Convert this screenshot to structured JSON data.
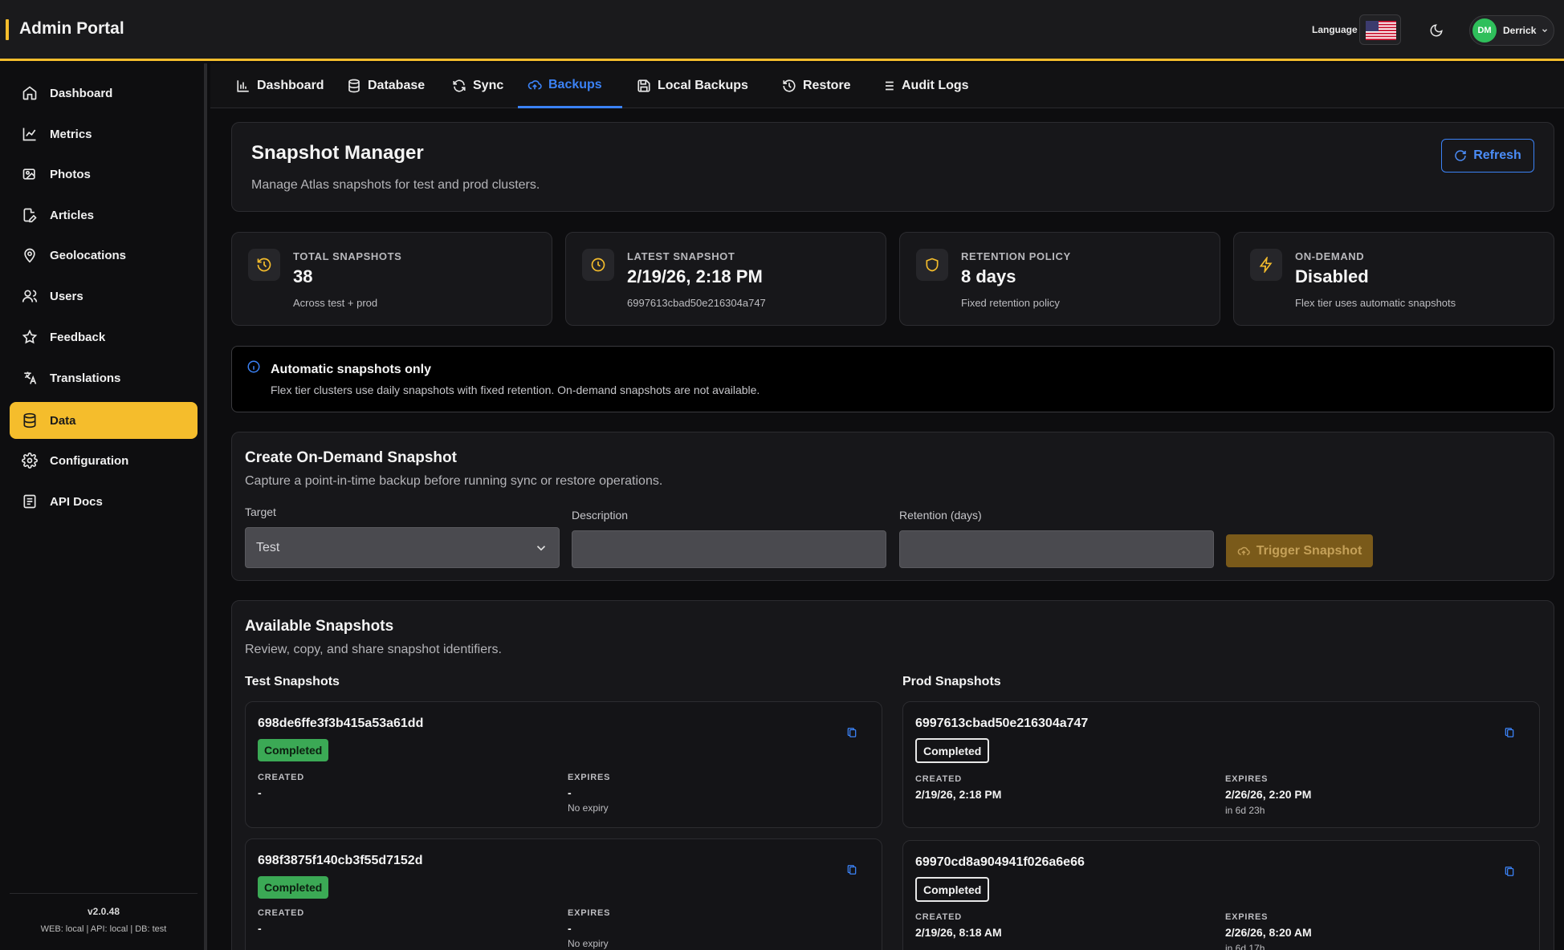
{
  "header": {
    "title": "Admin Portal",
    "language_label": "Language",
    "user": {
      "initials": "DM",
      "name": "Derrick"
    },
    "accent_color": "#f5bd2c"
  },
  "sidebar": {
    "items": [
      {
        "label": "Dashboard",
        "icon": "home-icon"
      },
      {
        "label": "Metrics",
        "icon": "chart-line-icon"
      },
      {
        "label": "Photos",
        "icon": "images-icon"
      },
      {
        "label": "Articles",
        "icon": "edit-file-icon"
      },
      {
        "label": "Geolocations",
        "icon": "map-pin-icon"
      },
      {
        "label": "Users",
        "icon": "users-icon"
      },
      {
        "label": "Feedback",
        "icon": "star-icon"
      },
      {
        "label": "Translations",
        "icon": "translate-icon"
      },
      {
        "label": "Data",
        "icon": "database-icon",
        "active": true
      },
      {
        "label": "Configuration",
        "icon": "gear-icon"
      },
      {
        "label": "API Docs",
        "icon": "document-icon"
      }
    ],
    "version": "v2.0.48",
    "env": "WEB: local  |  API: local  |  DB: test"
  },
  "tabs": [
    {
      "label": "Dashboard",
      "icon": "bar-chart-icon"
    },
    {
      "label": "Database",
      "icon": "database-icon"
    },
    {
      "label": "Sync",
      "icon": "sync-icon"
    },
    {
      "label": "Backups",
      "icon": "cloud-icon",
      "active": true
    },
    {
      "label": "Local Backups",
      "icon": "save-icon"
    },
    {
      "label": "Restore",
      "icon": "history-icon"
    },
    {
      "label": "Audit Logs",
      "icon": "list-icon"
    }
  ],
  "manager": {
    "title": "Snapshot Manager",
    "subtitle": "Manage Atlas snapshots for test and prod clusters.",
    "refresh_label": "Refresh"
  },
  "stats": [
    {
      "label": "TOTAL SNAPSHOTS",
      "value": "38",
      "note": "Across test + prod",
      "icon": "history-icon"
    },
    {
      "label": "LATEST SNAPSHOT",
      "value": "2/19/26, 2:18 PM",
      "note": "6997613cbad50e216304a747",
      "icon": "clock-icon"
    },
    {
      "label": "RETENTION POLICY",
      "value": "8 days",
      "note": "Fixed retention policy",
      "icon": "shield-icon"
    },
    {
      "label": "ON-DEMAND",
      "value": "Disabled",
      "note": "Flex tier uses automatic snapshots",
      "icon": "bolt-icon"
    }
  ],
  "notice": {
    "title": "Automatic snapshots only",
    "text": "Flex tier clusters use daily snapshots with fixed retention. On-demand snapshots are not available."
  },
  "create": {
    "title": "Create On-Demand Snapshot",
    "subtitle": "Capture a point-in-time backup before running sync or restore operations.",
    "target_label": "Target",
    "target_value": "Test",
    "description_label": "Description",
    "description_value": "",
    "retention_label": "Retention (days)",
    "retention_value": "",
    "trigger_label": "Trigger Snapshot"
  },
  "available": {
    "title": "Available Snapshots",
    "subtitle": "Review, copy, and share snapshot identifiers.",
    "test_heading": "Test Snapshots",
    "prod_heading": "Prod Snapshots",
    "created_key": "CREATED",
    "expires_key": "EXPIRES",
    "test": [
      {
        "id": "698de6ffe3f3b415a53a61dd",
        "status": "Completed",
        "created": "-",
        "expires": "-",
        "expires_note": "No expiry"
      },
      {
        "id": "698f3875f140cb3f55d7152d",
        "status": "Completed",
        "created": "-",
        "expires": "-",
        "expires_note": "No expiry"
      }
    ],
    "prod": [
      {
        "id": "6997613cbad50e216304a747",
        "status": "Completed",
        "created": "2/19/26, 2:18 PM",
        "expires": "2/26/26, 2:20 PM",
        "expires_note": "in 6d 23h"
      },
      {
        "id": "69970cd8a904941f026a6e66",
        "status": "Completed",
        "created": "2/19/26, 8:18 AM",
        "expires": "2/26/26, 8:20 AM",
        "expires_note": "in 6d 17h"
      }
    ]
  }
}
